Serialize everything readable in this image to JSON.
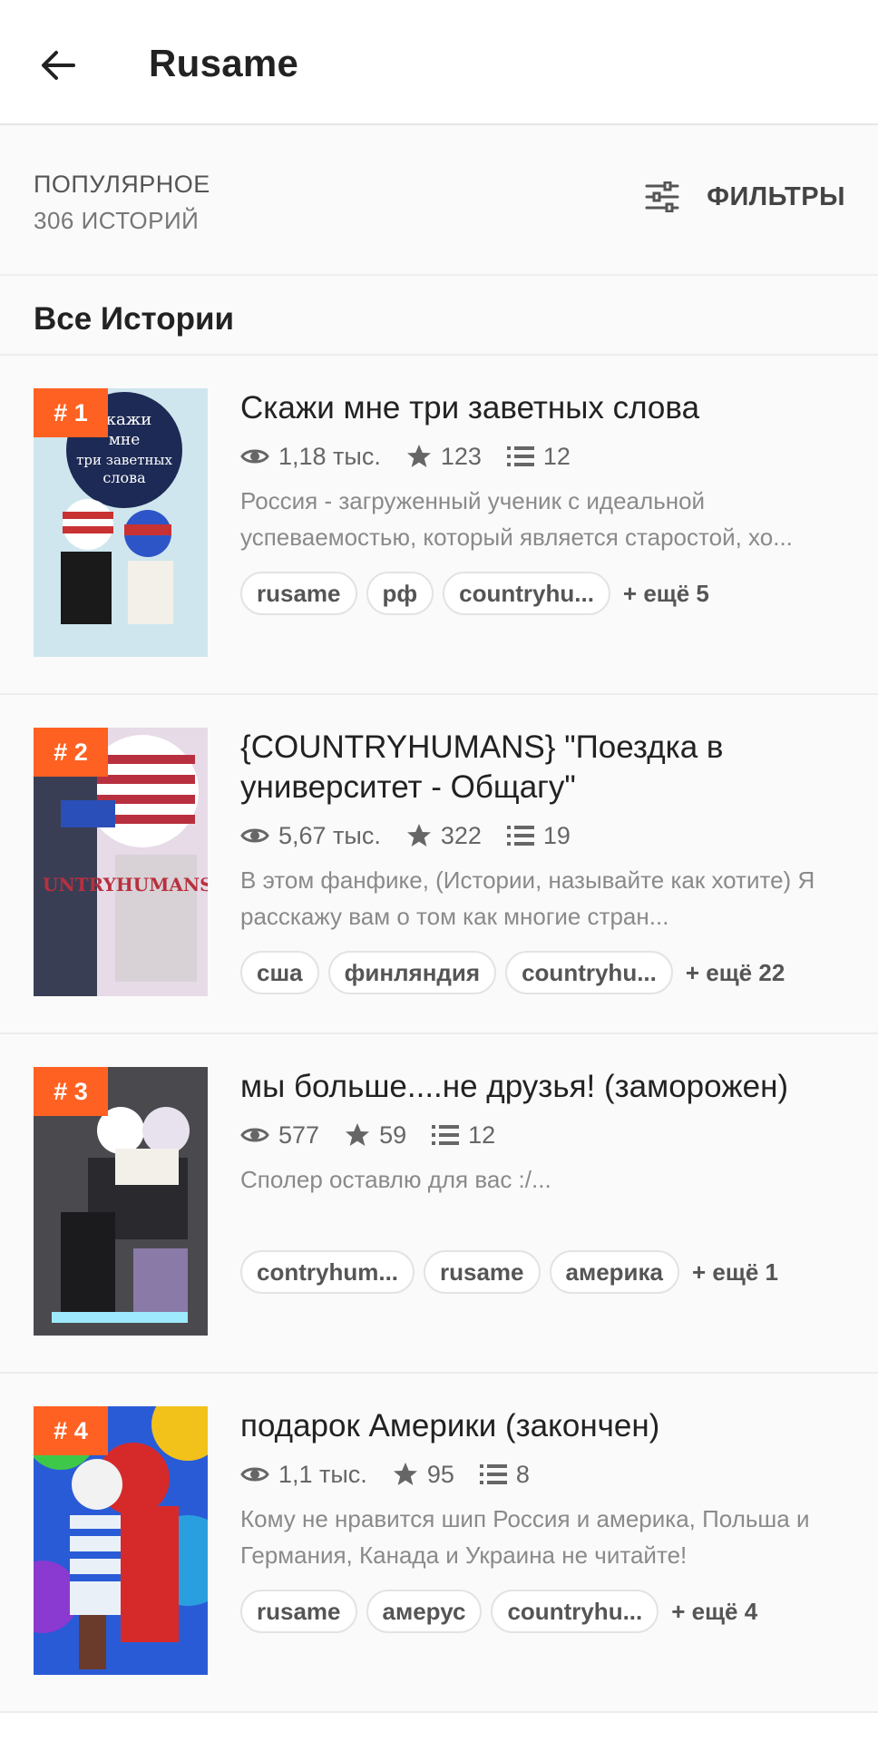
{
  "header": {
    "title": "Rusame"
  },
  "sort": {
    "title": "ПОПУЛЯРНОЕ",
    "count": "306 ИСТОРИЙ"
  },
  "filters": {
    "label": "ФИЛЬТРЫ"
  },
  "section": {
    "title": "Все Истории"
  },
  "stories": [
    {
      "rank": "# 1",
      "title": "Скажи мне три заветных слова",
      "reads": "1,18 тыс.",
      "votes": "123",
      "parts": "12",
      "desc": "Россия - загруженный ученик с идеальной успеваемостью, который является старостой, хо...",
      "tags": [
        "rusame",
        "рф",
        "countryhu..."
      ],
      "more": "+ ещё 5",
      "cover_text": "скажи мне три заветных слова",
      "cover_colors": [
        "#cfe6ee",
        "#1d2a55",
        "#c83232"
      ]
    },
    {
      "rank": "# 2",
      "title": "{COUNTRYHUMANS} \"Поездка в университет - Общагу\"",
      "reads": "5,67 тыс.",
      "votes": "322",
      "parts": "19",
      "desc": "В этом фанфике, (Истории, называйте как хотите) Я расскажу вам о том как многие стран...",
      "tags": [
        "сша",
        "финляндия",
        "countryhu..."
      ],
      "more": "+ ещё 22",
      "cover_text": "COUNTRYHUMANS",
      "cover_colors": [
        "#e7dbe8",
        "#3a3e55",
        "#b8303f"
      ]
    },
    {
      "rank": "# 3",
      "title": "мы больше....не друзья! (заморожен)",
      "reads": "577",
      "votes": "59",
      "parts": "12",
      "desc": "Сполер оставлю для вас :/...",
      "tags": [
        "contryhum...",
        "rusame",
        "америка"
      ],
      "more": "+ ещё 1",
      "cover_text": "",
      "cover_colors": [
        "#4a4a4e",
        "#2a2a2e",
        "#8a7aa8"
      ]
    },
    {
      "rank": "# 4",
      "title": "подарок Америки (закончен)",
      "reads": "1,1 тыс.",
      "votes": "95",
      "parts": "8",
      "desc": "Кому не нравится шип Россия и америка, Польша и Германия, Канада и Украина не читайте!",
      "tags": [
        "rusame",
        "амерус",
        "countryhu..."
      ],
      "more": "+ ещё 4",
      "cover_text": "",
      "cover_colors": [
        "#2a5bd6",
        "#d62a2a",
        "#f2c21a"
      ]
    }
  ]
}
